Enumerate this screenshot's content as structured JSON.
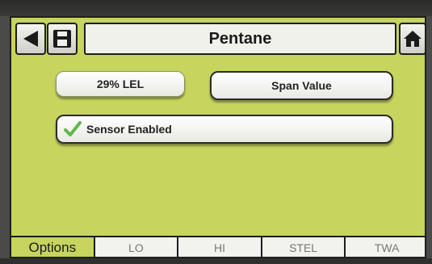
{
  "header": {
    "title": "Pentane",
    "back_icon": "back-arrow-icon",
    "save_icon": "floppy-disk-icon",
    "home_icon": "home-icon"
  },
  "main": {
    "value_display": "29% LEL",
    "span_button_label": "Span Value",
    "sensor_enabled_label": "Sensor Enabled",
    "sensor_enabled_checked": true
  },
  "tabs": [
    {
      "label": "Options",
      "active": true
    },
    {
      "label": "LO",
      "active": false
    },
    {
      "label": "HI",
      "active": false
    },
    {
      "label": "STEL",
      "active": false
    },
    {
      "label": "TWA",
      "active": false
    }
  ],
  "colors": {
    "screen_background": "#c7d45d",
    "check_green": "#5fb84a"
  }
}
